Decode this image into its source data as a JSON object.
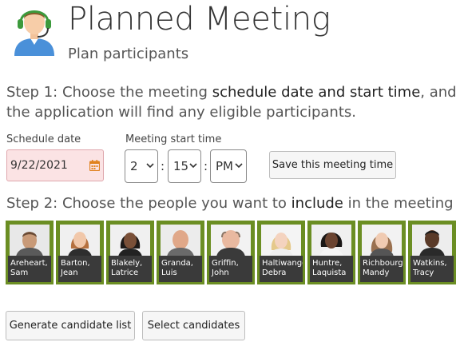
{
  "header": {
    "title": "Planned Meeting",
    "subtitle": "Plan participants",
    "icon": "support-agent-icon"
  },
  "step1": {
    "prefix": "Step 1: Choose the meeting ",
    "emphasis": "schedule date and start time",
    "suffix": ", and the application will find any eligible participants."
  },
  "schedule": {
    "date_label": "Schedule date",
    "date_value": "9/22/2021",
    "time_label": "Meeting start time",
    "hour": "2",
    "minute": "15",
    "ampm": "PM",
    "separator": ":",
    "save_button": "Save this meeting time"
  },
  "step2": {
    "prefix": "Step 2: Choose the people you want to ",
    "emphasis": "include",
    "suffix": " in the meeting"
  },
  "people": [
    {
      "name": "Areheart,\nSam"
    },
    {
      "name": "Barton,\nJean"
    },
    {
      "name": "Blakely,\nLatrice"
    },
    {
      "name": "Granda,\nLuis"
    },
    {
      "name": "Griffin,\nJohn"
    },
    {
      "name": "Haltiwanger\nDebra"
    },
    {
      "name": "Huntre,\nLaquista"
    },
    {
      "name": "Richbourg,\nMandy"
    },
    {
      "name": "Watkins,\nTracy"
    }
  ],
  "actions": {
    "generate": "Generate candidate list",
    "select": "Select candidates"
  },
  "colors": {
    "card_border": "#6b8e23",
    "date_bg": "#fbe3e4",
    "name_bg": "#3a3a3a"
  }
}
